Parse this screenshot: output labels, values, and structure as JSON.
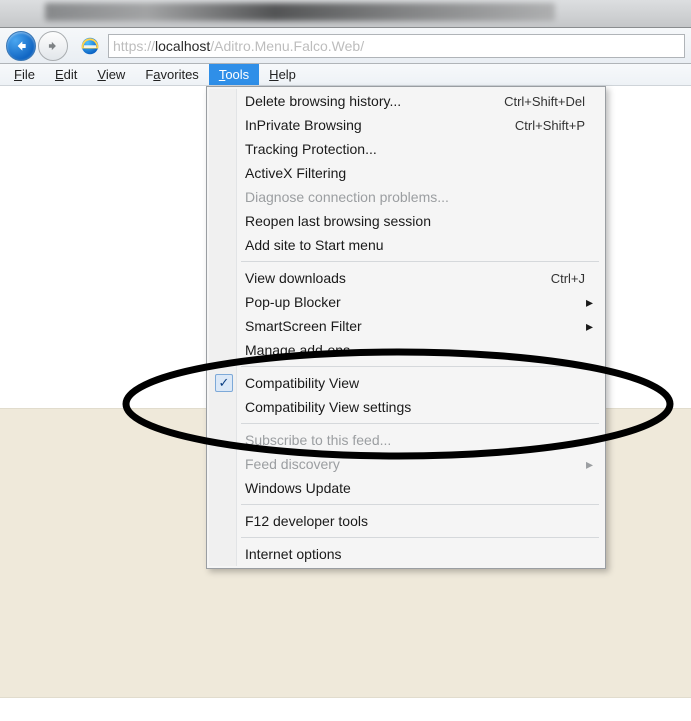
{
  "address": {
    "scheme": "https://",
    "host": "localhost",
    "path": "/Aditro.Menu.Falco.Web/"
  },
  "menubar": {
    "file": "File",
    "edit": "Edit",
    "view": "View",
    "favorites": "Favorites",
    "tools": "Tools",
    "help": "Help"
  },
  "tools_menu": {
    "delete_history": {
      "label": "Delete browsing history...",
      "shortcut": "Ctrl+Shift+Del"
    },
    "inprivate": {
      "label": "InPrivate Browsing",
      "shortcut": "Ctrl+Shift+P"
    },
    "tracking": {
      "label": "Tracking Protection..."
    },
    "activex": {
      "label": "ActiveX Filtering"
    },
    "diagnose": {
      "label": "Diagnose connection problems..."
    },
    "reopen": {
      "label": "Reopen last browsing session"
    },
    "addstart": {
      "label": "Add site to Start menu"
    },
    "downloads": {
      "label": "View downloads",
      "shortcut": "Ctrl+J"
    },
    "popup": {
      "label": "Pop-up Blocker"
    },
    "smartscreen": {
      "label": "SmartScreen Filter"
    },
    "addons": {
      "label": "Manage add-ons"
    },
    "compat_view": {
      "label": "Compatibility View",
      "checked": true
    },
    "compat_settings": {
      "label": "Compatibility View settings"
    },
    "subscribe": {
      "label": "Subscribe to this feed..."
    },
    "feed_discovery": {
      "label": "Feed discovery"
    },
    "win_update": {
      "label": "Windows Update"
    },
    "f12": {
      "label": "F12 developer tools"
    },
    "internet_options": {
      "label": "Internet options"
    }
  },
  "submenu_arrow": "▸",
  "check_glyph": "✓"
}
